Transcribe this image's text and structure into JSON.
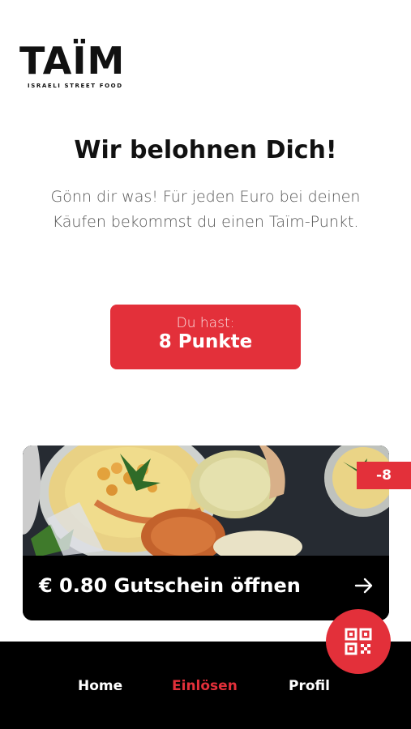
{
  "brand": {
    "name": "TAÏM",
    "tagline": "ISRAELI STREET FOOD"
  },
  "hero": {
    "title": "Wir belohnen Dich!",
    "description": "Gönn dir was! Für jeden Euro bei deinen Käufen bekommst du einen Taïm-Punkt."
  },
  "points": {
    "label": "Du hast:",
    "value": "8 Punkte"
  },
  "voucher": {
    "title": "€ 0.80 Gutschein öffnen",
    "cost_badge": "-8",
    "image_subject": "hummus bowls and drinks"
  },
  "nav": {
    "home": "Home",
    "redeem": "Einlösen",
    "profile": "Profil",
    "active": "redeem"
  },
  "colors": {
    "accent": "#e3303a",
    "background": "#ffffff",
    "dark": "#000000"
  }
}
